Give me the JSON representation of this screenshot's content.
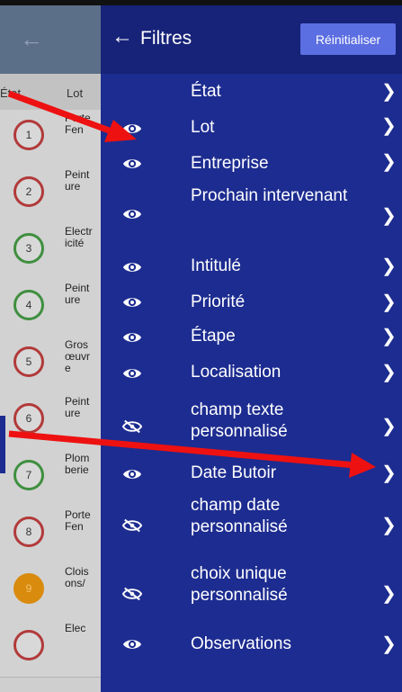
{
  "background": {
    "header": {
      "etat": "État",
      "lot": "Lot"
    },
    "rows": [
      {
        "number": "1",
        "color": "red",
        "lot": "Porte Fen"
      },
      {
        "number": "2",
        "color": "red",
        "lot": "Peinture"
      },
      {
        "number": "3",
        "color": "green",
        "lot": "Electricité"
      },
      {
        "number": "4",
        "color": "green",
        "lot": "Peinture"
      },
      {
        "number": "5",
        "color": "red",
        "lot": "Gros œuvre"
      },
      {
        "number": "6",
        "color": "red",
        "lot": "Peinture"
      },
      {
        "number": "7",
        "color": "green",
        "lot": "Plomberie"
      },
      {
        "number": "8",
        "color": "red",
        "lot": "Porte Fen"
      },
      {
        "number": "9",
        "color": "orange",
        "lot": "Cloisons/"
      },
      {
        "number": "",
        "color": "red",
        "lot": "Elec"
      }
    ]
  },
  "drawer": {
    "back_icon": "arrow-left-icon",
    "title": "Filtres",
    "reset_label": "Réinitialiser",
    "items": [
      {
        "label": "État",
        "eye": "none"
      },
      {
        "label": "Lot",
        "eye": "visible"
      },
      {
        "label": "Entreprise",
        "eye": "visible"
      },
      {
        "label": "Prochain intervenant",
        "eye": "visible"
      },
      {
        "label": "Intitulé",
        "eye": "visible"
      },
      {
        "label": "Priorité",
        "eye": "visible"
      },
      {
        "label": "Étape",
        "eye": "visible"
      },
      {
        "label": "Localisation",
        "eye": "visible"
      },
      {
        "label": "champ texte personnalisé",
        "eye": "hidden"
      },
      {
        "label": "Date Butoir",
        "eye": "visible"
      },
      {
        "label": "champ date personnalisé",
        "eye": "hidden"
      },
      {
        "label": "choix unique personnalisé",
        "eye": "hidden"
      },
      {
        "label": "Observations",
        "eye": "visible"
      }
    ],
    "chevron_icon": "chevron-right-icon"
  },
  "colors": {
    "drawer_bg": "#1d2c90",
    "reset_button": "#5b6ee2",
    "annotation_arrow": "#ee1111"
  }
}
